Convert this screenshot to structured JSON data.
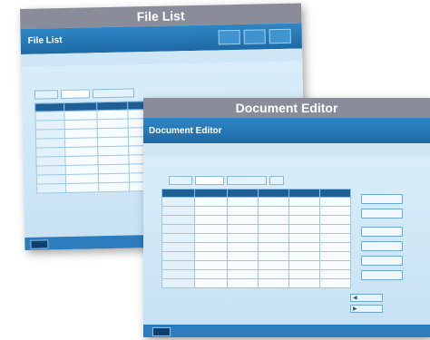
{
  "file_list": {
    "caption": "File List",
    "title_line1": "",
    "title": "File List",
    "header_buttons": [
      "",
      "",
      ""
    ],
    "tabs": [
      {
        "label": "",
        "active": false
      },
      {
        "label": "",
        "active": true
      },
      {
        "label": "",
        "active": false
      }
    ],
    "tab_trail": "",
    "columns": [
      "",
      "",
      "",
      ""
    ],
    "rows": 9
  },
  "document_editor": {
    "caption": "Document Editor",
    "title": "Document Editor",
    "tabs": [
      {
        "label": "",
        "active": false
      },
      {
        "label": "",
        "active": true
      },
      {
        "label": "",
        "active": false
      },
      {
        "label": "",
        "active": false
      }
    ],
    "columns": [
      "",
      "",
      "",
      "",
      "",
      ""
    ],
    "rows": 10,
    "side_buttons": [
      "",
      "",
      "",
      "",
      "",
      ""
    ],
    "nav_buttons": [
      {
        "label": "",
        "icon": "arrow-left-icon"
      },
      {
        "label": "",
        "icon": "arrow-right-icon"
      }
    ]
  },
  "colors": {
    "title_bar": "#1d6aa6",
    "caption_bar": "#8a8d99",
    "body": "#d8edf9",
    "table_header": "#1e5f95"
  }
}
